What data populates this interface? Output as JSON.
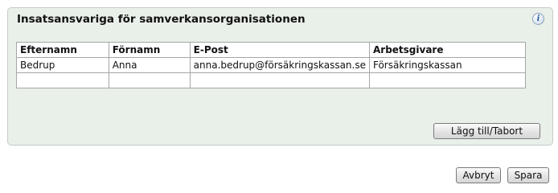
{
  "panel": {
    "title": "Insatsansvariga för samverkansorganisationen",
    "info_icon_glyph": "i"
  },
  "table": {
    "columns": [
      "Efternamn",
      "Förnamn",
      "E-Post",
      "Arbetsgivare"
    ],
    "rows": [
      [
        "Bedrup",
        "Anna",
        "anna.bedrup@försäkringskassan.se",
        "Försäkringskassan"
      ],
      [
        "",
        "",
        "",
        ""
      ]
    ]
  },
  "buttons": {
    "add_remove": "Lägg till/Tabort",
    "cancel": "Avbryt",
    "save": "Spara"
  }
}
